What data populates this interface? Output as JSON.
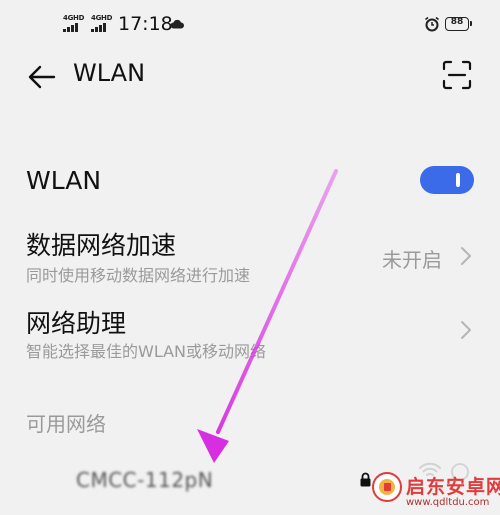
{
  "status_bar": {
    "signal_1_label": "4GHD",
    "signal_2_label": "4GHD",
    "time": "17:18",
    "battery": "88",
    "icons": [
      "signal-icon",
      "cloud-icon",
      "alarm-icon",
      "battery-icon"
    ]
  },
  "header": {
    "title": "WLAN",
    "back_icon": "arrow-left-icon",
    "scan_icon": "scan-icon"
  },
  "settings": {
    "wlan": {
      "title": "WLAN",
      "enabled": true
    },
    "acceleration": {
      "title": "数据网络加速",
      "subtitle": "同时使用移动数据网络进行加速",
      "value": "未开启"
    },
    "assistant": {
      "title": "网络助理",
      "subtitle": "智能选择最佳的WLAN或移动网络"
    }
  },
  "available_networks": {
    "header": "可用网络",
    "networks": [
      {
        "name": "CMCC-112pN",
        "secured": true
      }
    ]
  },
  "annotation": {
    "type": "arrow",
    "color": "#e040e8",
    "icon": "pointer-arrow-icon"
  },
  "watermark": {
    "text": "启东安卓网",
    "url": "www.qdltdu.com",
    "icon": "logo-icon",
    "colors": {
      "primary": "#e23b3b",
      "accent": "#f3b33d"
    }
  },
  "colors": {
    "accent": "#3b6be8",
    "background": "#f1f1f1",
    "secondary_text": "#9a9a9a"
  }
}
